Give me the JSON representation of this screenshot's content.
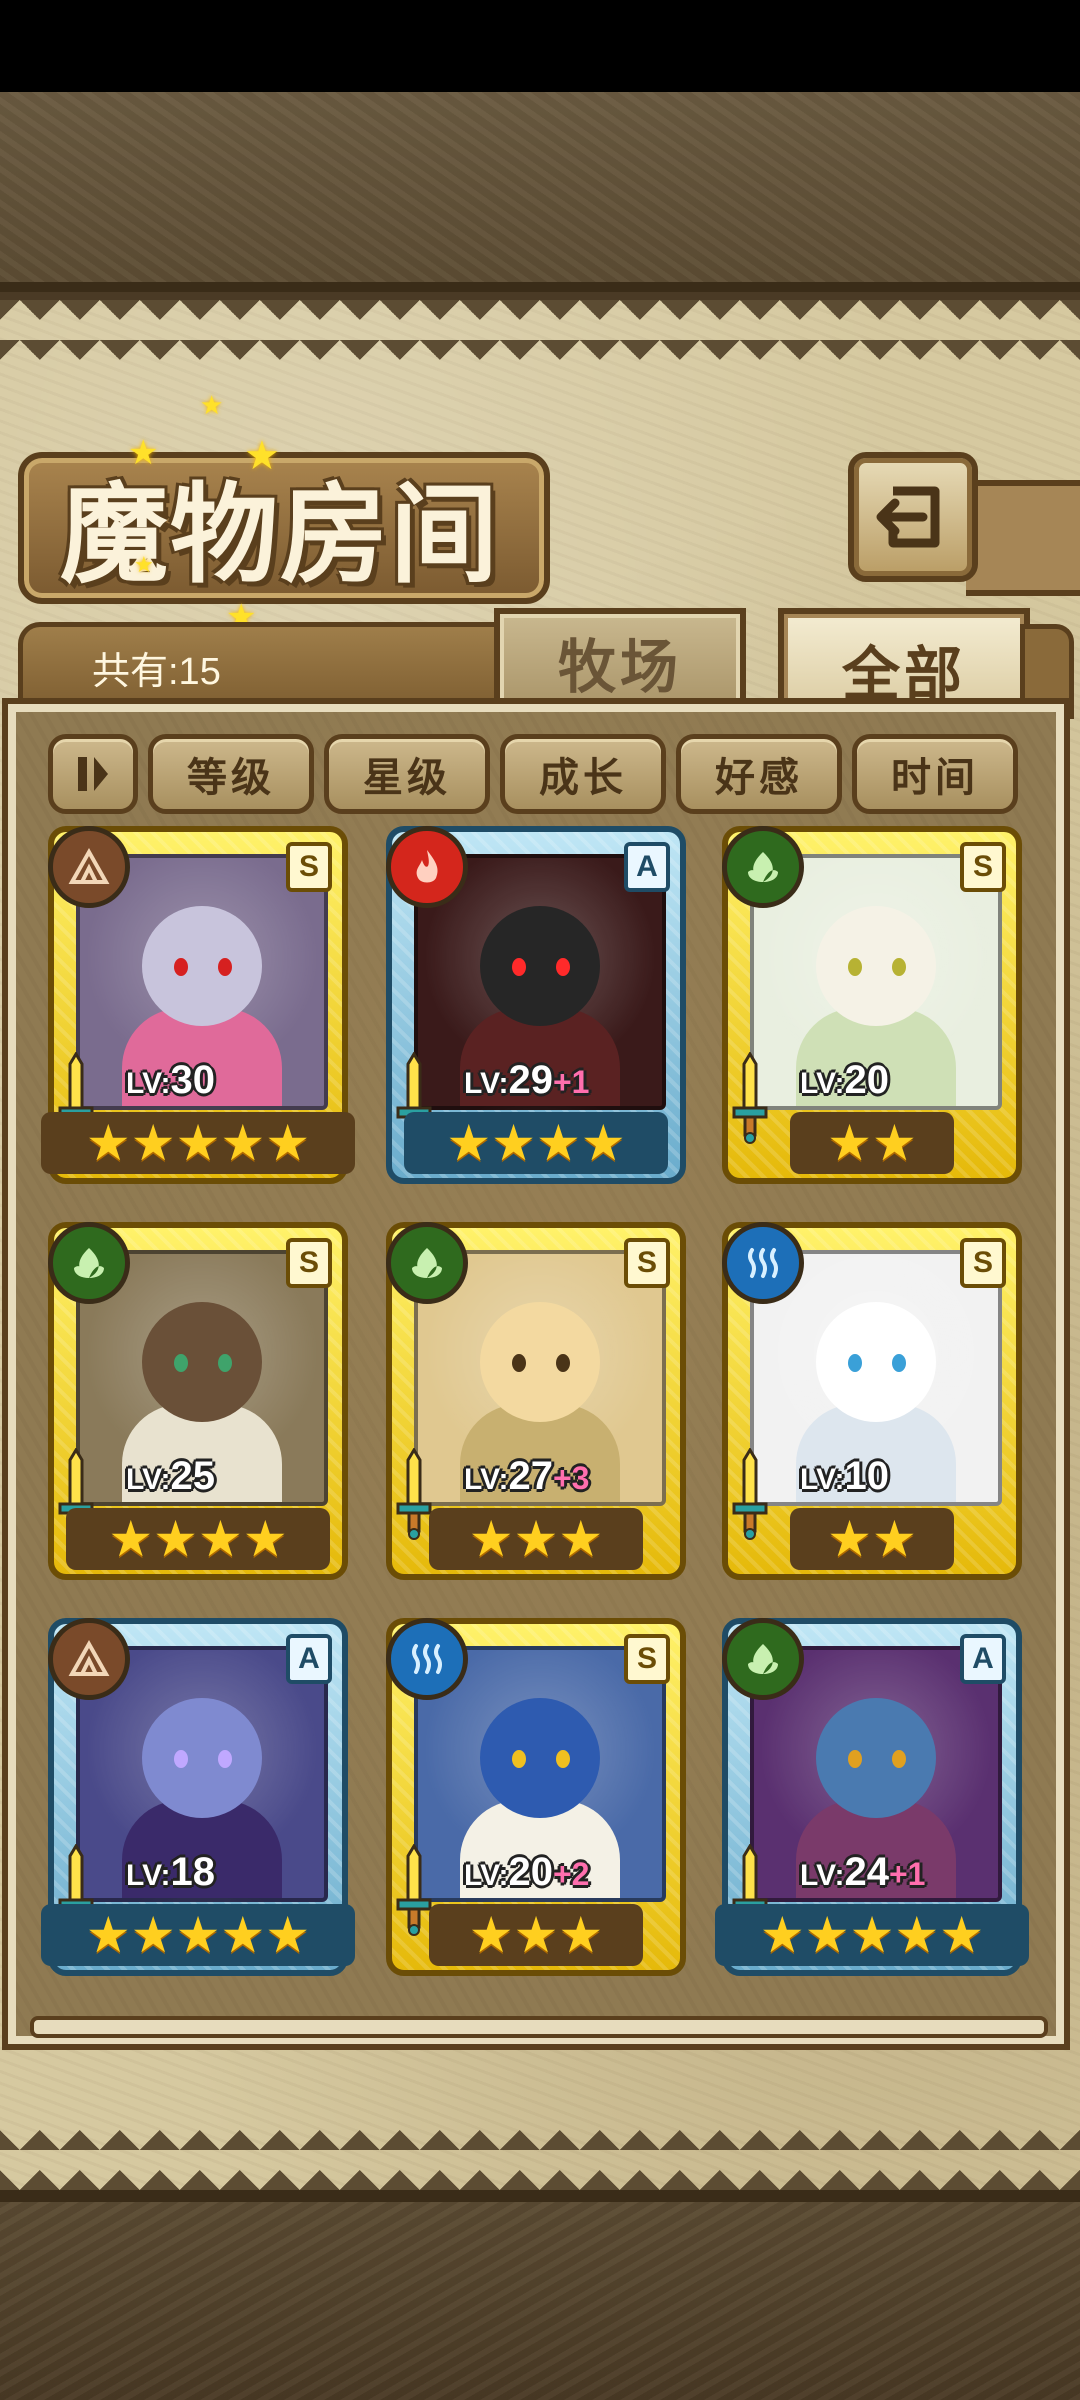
{
  "title": "魔物房间",
  "count_label": "共有:15",
  "tabs": [
    {
      "label": "牧场",
      "selected": false
    },
    {
      "label": "全部",
      "selected": true
    }
  ],
  "sort_buttons": [
    "等级",
    "星级",
    "成长",
    "好感",
    "时间"
  ],
  "sort_toggle_icon": "pause-icon",
  "back_icon": "return-arrow-icon",
  "monsters": [
    {
      "element": "earth",
      "rank": "S",
      "frame": "gold",
      "lv_prefix": "LV:",
      "level": "30",
      "bonus": "",
      "stars": 5
    },
    {
      "element": "fire",
      "rank": "A",
      "frame": "blue",
      "lv_prefix": "LV:",
      "level": "29",
      "bonus": "+1",
      "stars": 4
    },
    {
      "element": "wood",
      "rank": "S",
      "frame": "gold",
      "lv_prefix": "LV:",
      "level": "20",
      "bonus": "",
      "stars": 2
    },
    {
      "element": "wood",
      "rank": "S",
      "frame": "gold",
      "lv_prefix": "LV:",
      "level": "25",
      "bonus": "",
      "stars": 4
    },
    {
      "element": "wood",
      "rank": "S",
      "frame": "gold",
      "lv_prefix": "LV:",
      "level": "27",
      "bonus": "+3",
      "stars": 3
    },
    {
      "element": "water",
      "rank": "S",
      "frame": "gold",
      "lv_prefix": "LV:",
      "level": "10",
      "bonus": "",
      "stars": 2
    },
    {
      "element": "earth",
      "rank": "A",
      "frame": "blue",
      "lv_prefix": "LV:",
      "level": "18",
      "bonus": "",
      "stars": 5
    },
    {
      "element": "water",
      "rank": "S",
      "frame": "gold",
      "lv_prefix": "LV:",
      "level": "20",
      "bonus": "+2",
      "stars": 3
    },
    {
      "element": "wood",
      "rank": "A",
      "frame": "blue",
      "lv_prefix": "LV:",
      "level": "24",
      "bonus": "+1",
      "stars": 5
    }
  ],
  "colors": {
    "earth": "#7a4a2a",
    "fire": "#d4261c",
    "wood": "#2f6a1e",
    "water": "#1d6fb8",
    "level_bonus": "#ff6fae",
    "star": "#ffcf1f"
  }
}
